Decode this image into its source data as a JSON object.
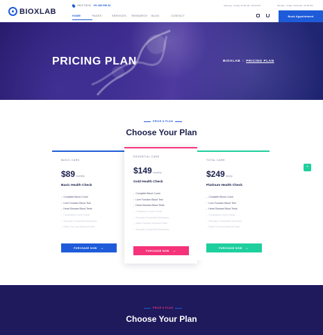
{
  "header": {
    "logo": "BIOXLAB",
    "help_label": "HELP DESK",
    "phone": "+61 383 538 26",
    "hours_1": "Saturday - Friday: 09.00 AM - 05.00 PM",
    "hours_2": "Monday - Friday: 09.00 AM - 06.00 PM",
    "nav": [
      "HOME",
      "PAGES",
      "SERVICES",
      "RESEARCH",
      "BLOG",
      "CONTACT"
    ],
    "book_label": "Book Appointment",
    "accent": "#1e5bd9"
  },
  "hero": {
    "title": "PRICING PLAN",
    "crumb_home": "BIOXLAB",
    "crumb_sep": ":",
    "crumb_current": "PRICING PLAN"
  },
  "pricing": {
    "eyebrow": "PRICE & PLAN",
    "title": "Choose Your Plan",
    "plans": [
      {
        "name": "BASIC CARE",
        "price": "$89",
        "period": "/monthly",
        "subtitle": "Basic Health Check",
        "color": "#1e5bd9",
        "features": [
          "Complete Blood Count",
          "Liver Function Blood Test",
          "Heart Disease Blood Tests",
          "Cholesterol Level Check",
          "Sexually Transmitted Diseases",
          "Basic Full-Lab Medical Exam"
        ],
        "button": "PURCHASE NOW"
      },
      {
        "name": "ESSENTIAL CARE",
        "price": "$149",
        "period": "/monthly",
        "subtitle": "Gold Health Check",
        "color": "#f5337a",
        "features": [
          "Complete Blood Count",
          "Liver Function Blood Test",
          "Heart Disease Blood Tests",
          "Cholesterol Level Check",
          "Sexually Transmitted Diseases",
          "Basic Female Hormone Tests",
          "Sexually Transmitted Diseases"
        ],
        "button": "PURCHASE NOW"
      },
      {
        "name": "TOTAL CARE",
        "price": "$249",
        "period": "/yearly",
        "subtitle": "Platinum Health Check",
        "color": "#1ecf9e",
        "features": [
          "Complete Blood Count",
          "Liver Function Blood Test",
          "Heart Disease Blood Tests",
          "Cholesterol Level Check",
          "Sexually Transmitted Diseases",
          "Basic Full-Lab Medical Exam"
        ],
        "button": "PURCHASE NOW"
      }
    ]
  },
  "band": {
    "eyebrow": "PRICE & PLAN",
    "title": "Choose Your Plan"
  },
  "float_button": "^"
}
